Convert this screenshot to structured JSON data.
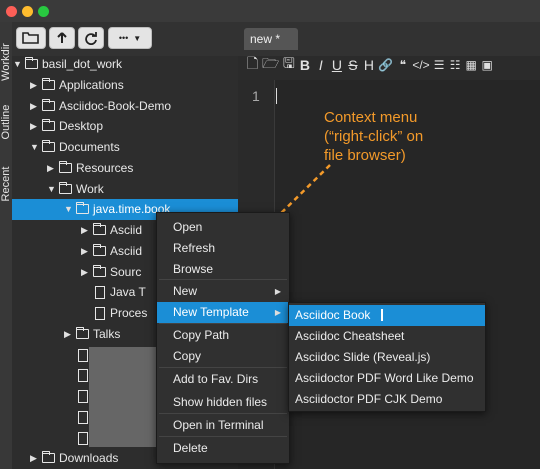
{
  "window": {
    "traffic_lights": [
      "#fd5f57",
      "#febc2e",
      "#28c840"
    ]
  },
  "toolbar": {
    "buttons": [
      {
        "name": "open-folder-button",
        "icon": "folder-open-icon"
      },
      {
        "name": "up-directory-button",
        "icon": "arrow-up-icon"
      },
      {
        "name": "refresh-button",
        "icon": "refresh-icon"
      },
      {
        "name": "more-button",
        "icon": "ellipsis-icon"
      }
    ],
    "more_label": "•••"
  },
  "side_tabs": [
    "Workdir",
    "Outline",
    "Recent"
  ],
  "tree": [
    {
      "label": "basil_dot_work",
      "depth": 0,
      "kind": "folder",
      "expanded": true
    },
    {
      "label": "Applications",
      "depth": 1,
      "kind": "folder",
      "expanded": false
    },
    {
      "label": "Asciidoc-Book-Demo",
      "depth": 1,
      "kind": "folder",
      "expanded": false
    },
    {
      "label": "Desktop",
      "depth": 1,
      "kind": "folder",
      "expanded": false
    },
    {
      "label": "Documents",
      "depth": 1,
      "kind": "folder",
      "expanded": true
    },
    {
      "label": "Resources",
      "depth": 2,
      "kind": "folder",
      "expanded": false
    },
    {
      "label": "Work",
      "depth": 2,
      "kind": "folder",
      "expanded": true
    },
    {
      "label": "java.time.book",
      "depth": 3,
      "kind": "folder",
      "expanded": true,
      "selected": true
    },
    {
      "label": "Asciid",
      "depth": 4,
      "kind": "folder",
      "expanded": false
    },
    {
      "label": "Asciid",
      "depth": 4,
      "kind": "folder",
      "expanded": false
    },
    {
      "label": "Sourc",
      "depth": 4,
      "kind": "folder",
      "expanded": false
    },
    {
      "label": "Java T",
      "depth": 4,
      "kind": "file"
    },
    {
      "label": "Proces",
      "depth": 4,
      "kind": "file"
    },
    {
      "label": "Talks",
      "depth": 3,
      "kind": "folder",
      "expanded": false
    },
    {
      "label": "",
      "depth": 3,
      "kind": "pdf"
    },
    {
      "label": "",
      "depth": 3,
      "kind": "pdf"
    },
    {
      "label": "",
      "depth": 3,
      "kind": "file"
    },
    {
      "label": "",
      "depth": 3,
      "kind": "file"
    },
    {
      "label": "",
      "depth": 3,
      "kind": "pdf"
    },
    {
      "label": "Downloads",
      "depth": 1,
      "kind": "folder",
      "expanded": false
    }
  ],
  "editor": {
    "tab_label": "new *",
    "line_numbers": [
      "1"
    ],
    "format_tools": [
      "new-file-icon",
      "open-file-icon",
      "save-icon",
      "bold-icon",
      "italic-icon",
      "underline-icon",
      "strikethrough-icon",
      "heading-icon",
      "link-icon",
      "quote-icon",
      "code-icon",
      "list-icon",
      "numbered-list-icon",
      "table-icon",
      "image-icon"
    ],
    "format_glyphs": [
      "🗋",
      "🗁",
      "🖫",
      "B",
      "I",
      "U",
      "S",
      "H",
      "🔗",
      "❝",
      "</>",
      "☰",
      "☷",
      "▦",
      "▣"
    ]
  },
  "annotation": {
    "lines": [
      "Context menu",
      "(“right-click” on",
      "file browser)"
    ],
    "color": "#f39a2a"
  },
  "context_menu": {
    "items": [
      "Open",
      "Refresh",
      "Browse",
      "New",
      "New Template",
      "Copy Path",
      "Copy",
      "Add to Fav. Dirs",
      "Show hidden files",
      "Open in Terminal",
      "Delete"
    ],
    "highlighted": "New Template",
    "has_submenu": [
      "New",
      "New Template"
    ]
  },
  "submenu": {
    "items": [
      "Asciidoc Book",
      "Asciidoc Cheatsheet",
      "Asciidoc Slide (Reveal.js)",
      "Asciidoctor PDF Word Like Demo",
      "Asciidoctor PDF CJK Demo"
    ],
    "highlighted": "Asciidoc Book"
  },
  "colors": {
    "selection": "#1b8ed6",
    "background": "#2b2b2b"
  }
}
